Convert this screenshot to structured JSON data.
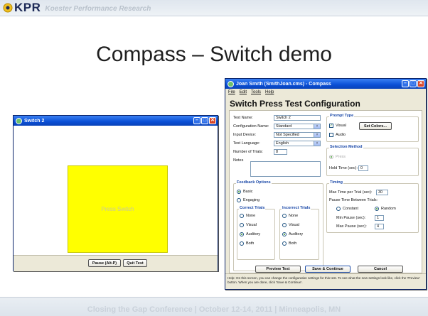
{
  "slide": {
    "logo_text": "KPR",
    "logo_subtitle": "Koester Performance Research",
    "title": "Compass – Switch demo",
    "footer": "Closing the Gap Conference  |  October 12-14, 2011  |  Minneapolis, MN"
  },
  "switch_window": {
    "title": "Switch 2",
    "press_label": "Press Switch",
    "pause_button": "Pause (Alt-P)",
    "quit_button": "Quit Test"
  },
  "compass_window": {
    "title": "Joan Smith (SmithJoan.cms) - Compass",
    "menu": [
      "File",
      "Edit",
      "Tools",
      "Help"
    ],
    "heading": "Switch Press Test Configuration",
    "fields": {
      "test_name_label": "Test Name:",
      "test_name_value": "Switch 2",
      "config_name_label": "Configuration Name:",
      "config_name_value": "Standard",
      "input_device_label": "Input Device:",
      "input_device_value": "Not Specified",
      "test_language_label": "Test Language:",
      "test_language_value": "English",
      "num_trials_label": "Number of Trials:",
      "num_trials_value": "8",
      "notes_label": "Notes"
    },
    "prompt_type": {
      "title": "Prompt Type",
      "visual_label": "Visual",
      "audio_label": "Audio",
      "set_colors_button": "Set Colors..."
    },
    "selection_method": {
      "title": "Selection Method",
      "press_label": "Press",
      "hold_time_label": "Hold Time (sec):",
      "hold_time_value": "0"
    },
    "feedback_options": {
      "title": "Feedback Options",
      "basic_label": "Basic",
      "engaging_label": "Engaging",
      "correct_title": "Correct Trials",
      "incorrect_title": "Incorrect Trials",
      "options": [
        "None",
        "Visual",
        "Auditory",
        "Both"
      ]
    },
    "timing": {
      "title": "Timing",
      "max_time_label": "Max Time per Trial (sec):",
      "max_time_value": "30",
      "pause_between_label": "Pause Time Between Trials:",
      "constant_label": "Constant",
      "random_label": "Random",
      "min_pause_label": "Min Pause (sec):",
      "min_pause_value": "1",
      "max_pause_label": "Max Pause (sec):",
      "max_pause_value": "4"
    },
    "buttons": {
      "preview": "Preview Test",
      "save": "Save & Continue",
      "cancel": "Cancel"
    },
    "help_text": "Help: On this screen, you can change the configuration settings for this test.  To see what the new settings look like, click the 'Preview' button.  When you are done, click 'Save & Continue'."
  }
}
